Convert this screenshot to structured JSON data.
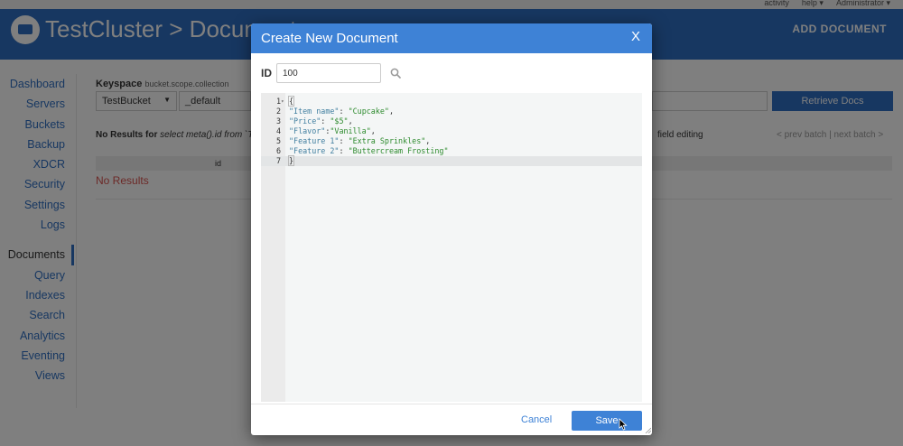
{
  "topbar": {
    "links": [
      "activity",
      "help ▾",
      "Administrator ▾"
    ]
  },
  "header": {
    "title": "TestCluster > Documents",
    "add_document": "ADD DOCUMENT"
  },
  "sidebar": {
    "group1": [
      "Dashboard",
      "Servers",
      "Buckets",
      "Backup",
      "XDCR",
      "Security",
      "Settings",
      "Logs"
    ],
    "group2": [
      "Documents",
      "Query",
      "Indexes",
      "Search",
      "Analytics",
      "Eventing",
      "Views"
    ],
    "active": "Documents"
  },
  "main": {
    "keyspace_label": "Keyspace",
    "keyspace_hint": "bucket.scope.collection",
    "bucket_value": "TestBucket",
    "scope_value": "_default",
    "retrieve_label": "Retrieve Docs",
    "no_results_prefix": "No Results for",
    "no_results_query": "select meta().id from `Te",
    "field_editing": "field editing",
    "batch_nav": "< prev batch  |  next batch >",
    "column_id": "id",
    "no_results": "No Results"
  },
  "modal": {
    "title": "Create New Document",
    "close": "X",
    "id_label": "ID",
    "id_value": "100",
    "cancel_label": "Cancel",
    "save_label": "Save",
    "icons": {
      "search": "search-icon",
      "close": "close-icon",
      "pointer": "mouse-pointer-icon",
      "resize": "resize-handle-icon"
    },
    "editor_lines": [
      {
        "num": "1",
        "parts": [
          [
            "punc",
            "{"
          ]
        ]
      },
      {
        "num": "2",
        "parts": [
          [
            "key",
            "\"Item name\""
          ],
          [
            "punc",
            ": "
          ],
          [
            "str",
            "\"Cupcake\""
          ],
          [
            "punc",
            ","
          ]
        ]
      },
      {
        "num": "3",
        "parts": [
          [
            "key",
            "\"Price\""
          ],
          [
            "punc",
            ": "
          ],
          [
            "str",
            "\"$5\""
          ],
          [
            "punc",
            ","
          ]
        ]
      },
      {
        "num": "4",
        "parts": [
          [
            "key",
            "\"Flavor\""
          ],
          [
            "punc",
            ":"
          ],
          [
            "str",
            "\"Vanilla\""
          ],
          [
            "punc",
            ","
          ]
        ]
      },
      {
        "num": "5",
        "parts": [
          [
            "key",
            "\"Feature 1\""
          ],
          [
            "punc",
            ": "
          ],
          [
            "str",
            "\"Extra Sprinkles\""
          ],
          [
            "punc",
            ","
          ]
        ]
      },
      {
        "num": "6",
        "parts": [
          [
            "key",
            "\"Feature 2\""
          ],
          [
            "punc",
            ": "
          ],
          [
            "str",
            "\"Buttercream Frosting\""
          ]
        ]
      },
      {
        "num": "7",
        "parts": [
          [
            "punc",
            "}"
          ]
        ]
      }
    ],
    "active_line": "7"
  },
  "colors": {
    "header": "#2f6fc3",
    "modal_header": "#3e82d6",
    "error": "#d9534f",
    "json_key": "#417fa0",
    "json_string": "#2e8b2e"
  }
}
